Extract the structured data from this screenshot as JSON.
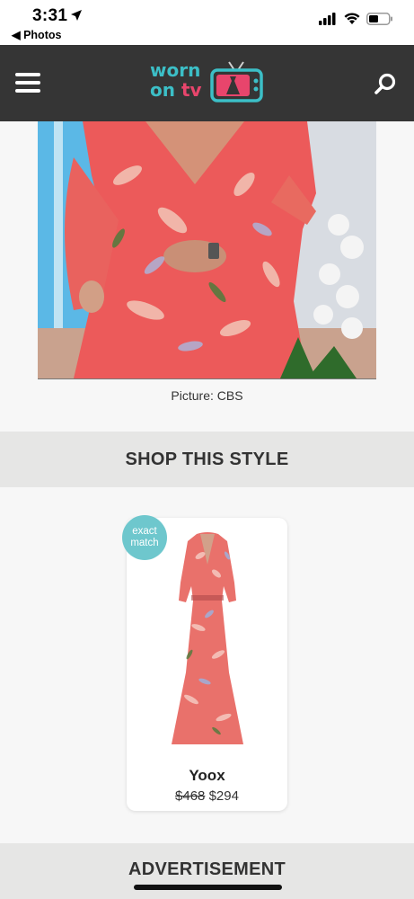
{
  "status_bar": {
    "time": "3:31",
    "back_label": "◀ Photos"
  },
  "header": {
    "logo_line1": "worn",
    "logo_line2_a": "on ",
    "logo_line2_b": "tv",
    "colors": {
      "bar": "#353535",
      "teal": "#3cbfc7",
      "pink": "#e8456c"
    }
  },
  "hero": {
    "caption": "Picture: CBS"
  },
  "shop_section": {
    "title": "SHOP THIS STYLE"
  },
  "product": {
    "badge_line1": "exact",
    "badge_line2": "match",
    "store": "Yoox",
    "old_price": "$468",
    "price": "$294"
  },
  "ad_section": {
    "title": "ADVERTISEMENT"
  }
}
